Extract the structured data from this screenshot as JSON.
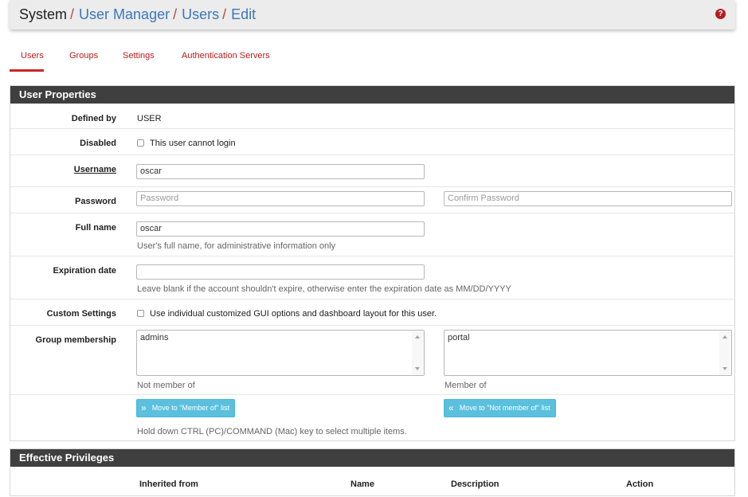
{
  "breadcrumb": {
    "items": [
      "System",
      "User Manager",
      "Users",
      "Edit"
    ],
    "separator": "/"
  },
  "help_icon": "question-circle-icon",
  "tabs": [
    {
      "label": "Users",
      "active": true
    },
    {
      "label": "Groups",
      "active": false
    },
    {
      "label": "Settings",
      "active": false
    },
    {
      "label": "Authentication Servers",
      "active": false
    }
  ],
  "user_properties": {
    "title": "User Properties",
    "defined_by": {
      "label": "Defined by",
      "value": "USER"
    },
    "disabled": {
      "label": "Disabled",
      "checkbox_text": "This user cannot login",
      "checked": false
    },
    "username": {
      "label": "Username",
      "value": "oscar"
    },
    "password": {
      "label": "Password",
      "placeholder": "Password",
      "confirm_placeholder": "Confirm Password"
    },
    "full_name": {
      "label": "Full name",
      "value": "oscar",
      "help": "User's full name, for administrative information only"
    },
    "expiration": {
      "label": "Expiration date",
      "value": "",
      "help": "Leave blank if the account shouldn't expire, otherwise enter the expiration date as MM/DD/YYYY"
    },
    "custom_settings": {
      "label": "Custom Settings",
      "checkbox_text": "Use individual customized GUI options and dashboard layout for this user.",
      "checked": false
    },
    "group_membership": {
      "label": "Group membership",
      "not_member_of": [
        "admins"
      ],
      "not_member_caption": "Not member of",
      "member_of": [
        "portal"
      ],
      "member_caption": "Member of",
      "move_to_member_label": "Move to \"Member of\" list",
      "move_to_not_member_label": "Move to \"Not member of\" list",
      "help": "Hold down CTRL (PC)/COMMAND (Mac) key to select multiple items."
    }
  },
  "effective_privileges": {
    "title": "Effective Privileges",
    "columns": [
      "Inherited from",
      "Name",
      "Description",
      "Action"
    ]
  },
  "colors": {
    "link": "#3b77ba",
    "tab_red": "#b71c1c",
    "panel_heading": "#3f3f3f",
    "info_button": "#5bc0de"
  }
}
